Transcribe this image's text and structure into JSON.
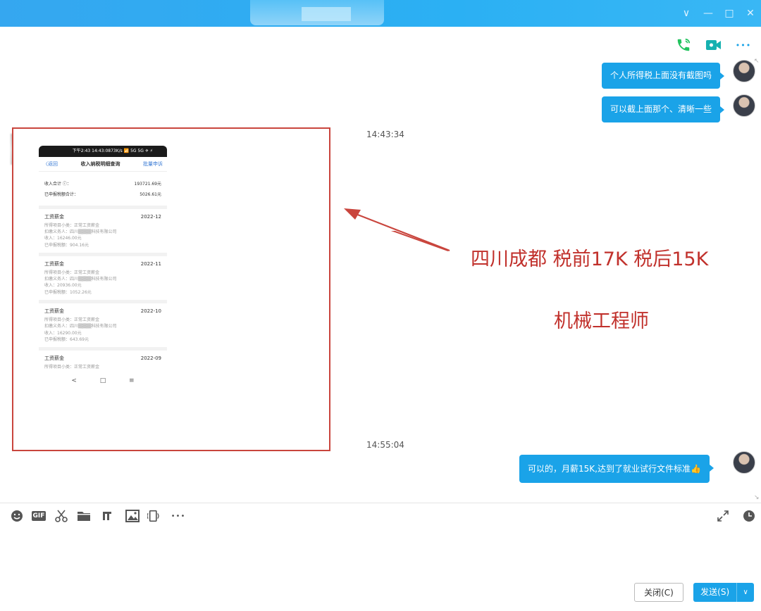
{
  "window": {
    "controls": {
      "dropdown": "∨",
      "minimize": "—",
      "maximize": "□",
      "close": "✕"
    }
  },
  "chat_header": {
    "icons": [
      "phone-icon",
      "video-call-icon",
      "more-icon"
    ],
    "more_glyph": "•••"
  },
  "messages": {
    "out_1": "个人所得税上面没有截图吗",
    "out_2": "可以截上面那个、清晰一些",
    "time_1": "14:43:34",
    "time_2": "14:55:04",
    "out_3": "可以的，月薪15K,达到了就业试行文件标准👍"
  },
  "screenshot": {
    "status": "下午2:43    14:43:0873K/s 📶 5G 5G ✈ ⚡",
    "back": "〈返回",
    "title": "收入纳税明细查询",
    "action": "批量申诉",
    "income_label": "收入合计 ⓘ：",
    "income_value": "193721.69元",
    "tax_label": "已申报税额合计：",
    "tax_value": "5026.61元",
    "items": [
      {
        "title": "工资薪金",
        "date": "2022-12",
        "l1": "所得项目小类：正常工资薪金",
        "l2": "扣缴义务人：四川▒▒▒▒科技有限公司",
        "l3": "收入：16246.00元",
        "l4": "已申报税额：904.16元"
      },
      {
        "title": "工资薪金",
        "date": "2022-11",
        "l1": "所得项目小类：正常工资薪金",
        "l2": "扣缴义务人：四川▒▒▒▒科技有限公司",
        "l3": "收入：20936.00元",
        "l4": "已申报税额：1052.26元"
      },
      {
        "title": "工资薪金",
        "date": "2022-10",
        "l1": "所得项目小类：正常工资薪金",
        "l2": "扣缴义务人：四川▒▒▒▒科技有限公司",
        "l3": "收入：16290.00元",
        "l4": "已申报税额：643.69元"
      },
      {
        "title": "工资薪金",
        "date": "2022-09",
        "l1": "所得项目小类：正常工资薪金"
      }
    ],
    "nav": [
      "<",
      "□",
      "≡"
    ]
  },
  "annotation": {
    "line1": "四川成都  税前17K 税后15K",
    "line2": "机械工程师",
    "color": "#c1312c"
  },
  "toolbar": {
    "tools": [
      "emoji-icon",
      "gif-icon",
      "scissors-icon",
      "folder-icon",
      "music-icon",
      "image-icon",
      "screen-share-icon",
      "more-icon"
    ],
    "gif_label": "GIF",
    "more_glyph": "•••"
  },
  "buttons": {
    "close": "关闭(C)",
    "send": "发送(S)",
    "send_dropdown": "∨"
  },
  "colors": {
    "titlebar": "#35a7f0",
    "bubble": "#1aa3e8",
    "phone_icon": "#22c35e",
    "video_icon": "#16b1b0"
  }
}
